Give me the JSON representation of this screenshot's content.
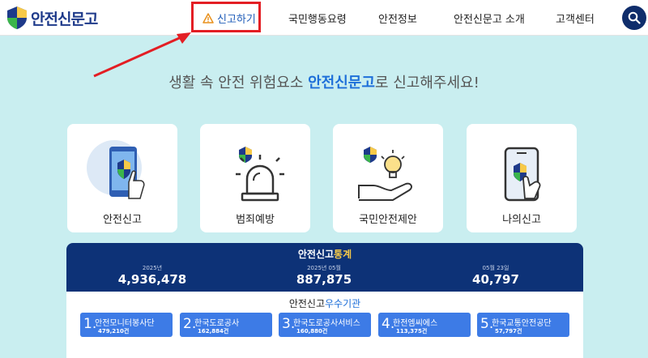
{
  "header": {
    "logo_text": "안전신문고",
    "nav": [
      {
        "label": "신고하기"
      },
      {
        "label": "국민행동요령"
      },
      {
        "label": "안전정보"
      },
      {
        "label": "안전신문고 소개"
      },
      {
        "label": "고객센터"
      }
    ],
    "search_icon": "search-icon"
  },
  "headline": {
    "before": "생활 속 안전 위험요소 ",
    "accent": "안전신문고",
    "after": "로 신고해주세요!"
  },
  "cards": [
    {
      "label": "안전신고",
      "icon": "phone-report-icon"
    },
    {
      "label": "범죄예방",
      "icon": "siren-icon"
    },
    {
      "label": "국민안전제안",
      "icon": "idea-hand-icon"
    },
    {
      "label": "나의신고",
      "icon": "my-report-phone-icon"
    }
  ],
  "stats": {
    "title_main": "안전신고",
    "title_accent": "통계",
    "items": [
      {
        "label": "2025년",
        "value": "4,936,478"
      },
      {
        "label": "2025년 05월",
        "value": "887,875"
      },
      {
        "label": "05월 23일",
        "value": "40,797"
      }
    ]
  },
  "orgs": {
    "title_main": "안전신고",
    "title_accent": "우수기관",
    "items": [
      {
        "num": "1.",
        "name": "안전모니터봉사단",
        "count": "479,210건"
      },
      {
        "num": "2.",
        "name": "한국도로공사",
        "count": "162,884건"
      },
      {
        "num": "3.",
        "name": "한국도로공사서비스",
        "count": "160,880건"
      },
      {
        "num": "4.",
        "name": "한전엠씨에스",
        "count": "113,375건"
      },
      {
        "num": "5.",
        "name": "한국교통안전공단",
        "count": "57,797건"
      }
    ]
  },
  "colors": {
    "brand_navy": "#0d3277",
    "accent_blue": "#1e6fd9",
    "highlight_red": "#e31e24",
    "background": "#c9eef0"
  }
}
